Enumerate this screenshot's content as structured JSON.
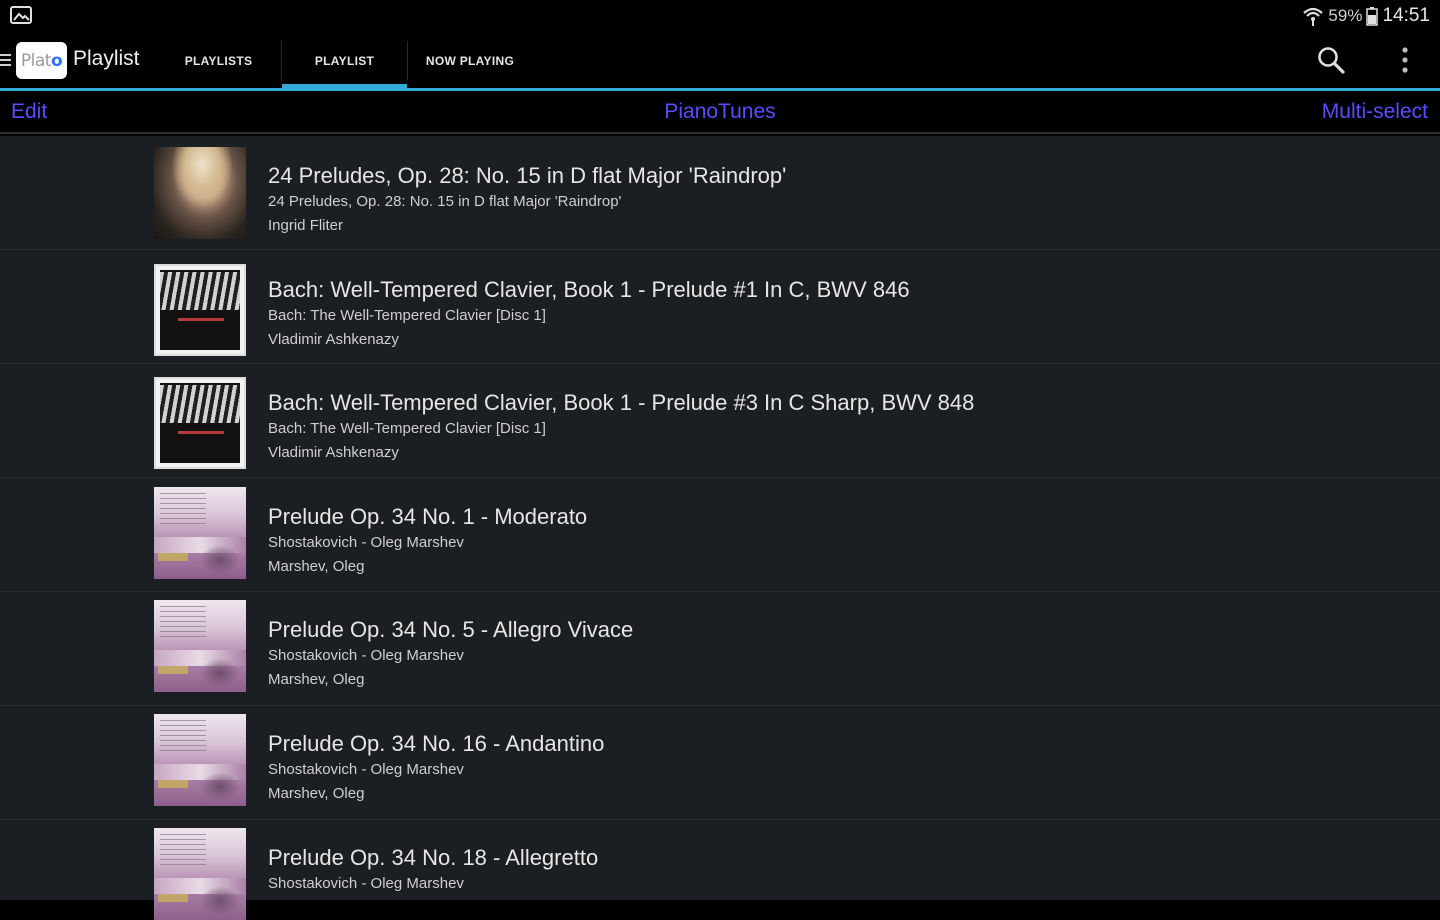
{
  "status_bar": {
    "left_icon": "image-notification-icon",
    "wifi_icon": "wifi-icon",
    "battery_percent": "59%",
    "battery_icon": "battery-icon",
    "time": "14:51"
  },
  "action_bar": {
    "drawer_icon": "menu-icon",
    "logo_text": "Plat",
    "logo_dot": "o",
    "title": "Playlist",
    "tabs": [
      {
        "label": "PLAYLISTS",
        "active": false
      },
      {
        "label": "PLAYLIST",
        "active": true
      },
      {
        "label": "NOW PLAYING",
        "active": false
      }
    ],
    "search_icon": "search-icon",
    "overflow_icon": "more-vert-icon"
  },
  "sub_header": {
    "edit_label": "Edit",
    "playlist_name": "PianoTunes",
    "multi_select_label": "Multi-select"
  },
  "tracks": [
    {
      "title": "24 Preludes, Op. 28: No. 15 in D flat Major 'Raindrop'",
      "album": "24 Preludes, Op. 28: No. 15 in D flat Major 'Raindrop'",
      "artist": "Ingrid Fliter",
      "art": "portrait"
    },
    {
      "title": "Bach: Well-Tempered Clavier, Book 1 - Prelude #1 In C, BWV 846",
      "album": "Bach: The Well-Tempered Clavier [Disc 1]",
      "artist": "Vladimir Ashkenazy",
      "art": "bach"
    },
    {
      "title": "Bach: Well-Tempered Clavier, Book 1 - Prelude #3 In C Sharp, BWV 848",
      "album": "Bach: The Well-Tempered Clavier [Disc 1]",
      "artist": "Vladimir Ashkenazy",
      "art": "bach"
    },
    {
      "title": "Prelude Op. 34 No. 1 - Moderato",
      "album": "Shostakovich - Oleg Marshev",
      "artist": "Marshev, Oleg",
      "art": "shosta"
    },
    {
      "title": "Prelude Op. 34 No. 5 - Allegro Vivace",
      "album": "Shostakovich - Oleg Marshev",
      "artist": "Marshev, Oleg",
      "art": "shosta"
    },
    {
      "title": "Prelude Op. 34 No. 16 - Andantino",
      "album": "Shostakovich - Oleg Marshev",
      "artist": "Marshev, Oleg",
      "art": "shosta"
    },
    {
      "title": "Prelude Op. 34 No. 18 - Allegretto",
      "album": "Shostakovich - Oleg Marshev",
      "artist": "",
      "art": "shosta"
    }
  ],
  "colors": {
    "accent": "#33a9d6",
    "link": "#5a4cff",
    "list_bg": "#1b1e22"
  }
}
